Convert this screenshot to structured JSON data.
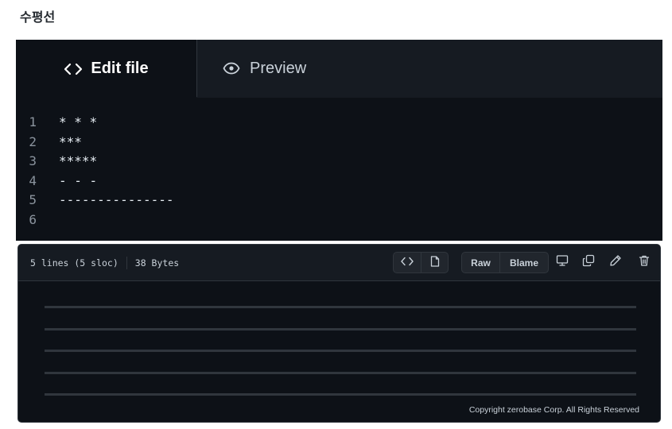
{
  "page": {
    "title": "수평선"
  },
  "editor": {
    "tabs": {
      "edit": "Edit file",
      "preview": "Preview"
    },
    "lines": [
      {
        "number": "1",
        "text": "* * *"
      },
      {
        "number": "2",
        "text": "***"
      },
      {
        "number": "3",
        "text": "*****"
      },
      {
        "number": "4",
        "text": "- - -"
      },
      {
        "number": "5",
        "text": "---------------"
      },
      {
        "number": "6",
        "text": ""
      }
    ]
  },
  "viewer": {
    "lines_info": "5 lines (5 sloc)",
    "size_info": "38 Bytes",
    "raw_label": "Raw",
    "blame_label": "Blame",
    "icons": [
      "code-icon",
      "file-icon",
      "desktop-icon",
      "copy-icon",
      "pencil-icon",
      "trash-icon"
    ],
    "rendered_horizontal_rules": 5,
    "copyright": "Copyright zerobase Corp. All Rights Reserved"
  },
  "colors": {
    "background": "#0d1117",
    "header": "#161b22",
    "border": "#30363d",
    "text": "#c9d1d9"
  }
}
